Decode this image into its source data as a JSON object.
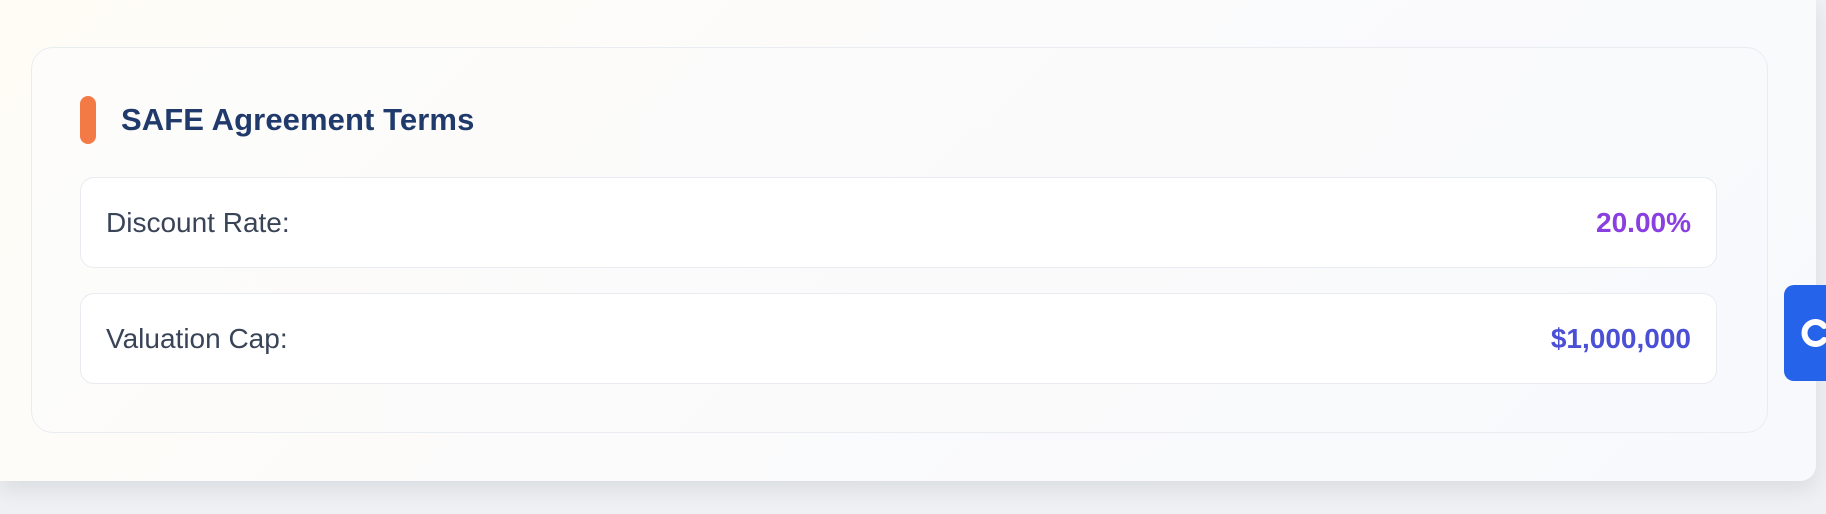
{
  "safe_terms": {
    "title": "SAFE Agreement Terms",
    "accent_color": "#f47a45",
    "rows": [
      {
        "label": "Discount Rate:",
        "value": "20.00%",
        "value_color": "#8a3fe0"
      },
      {
        "label": "Valuation Cap:",
        "value": "$1,000,000",
        "value_color": "#4b4fd6"
      }
    ]
  },
  "side_action": {
    "icon": "refresh-icon",
    "color": "#2563eb"
  }
}
